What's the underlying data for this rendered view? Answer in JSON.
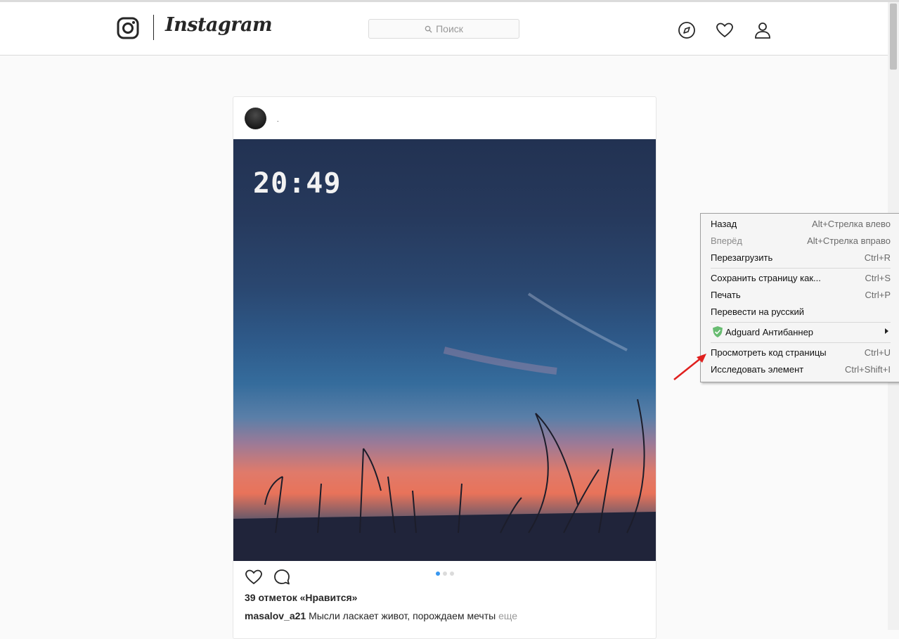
{
  "header": {
    "logo_text": "Instagram",
    "search_placeholder": "Поиск"
  },
  "post": {
    "clock_text": "20:49",
    "username_marker": ".",
    "likes": "39 отметок «Нравится»",
    "caption_user": "masalov_a21",
    "caption_text": "Мысли ласкает живот, порождаем мечты",
    "caption_more": "еще",
    "carousel_total": 3,
    "carousel_active": 1
  },
  "context_menu": {
    "items": [
      {
        "label": "Назад",
        "shortcut": "Alt+Стрелка влево",
        "enabled": true
      },
      {
        "label": "Вперёд",
        "shortcut": "Alt+Стрелка вправо",
        "enabled": false
      },
      {
        "label": "Перезагрузить",
        "shortcut": "Ctrl+R",
        "enabled": true
      },
      {
        "label": "Сохранить страницу как...",
        "shortcut": "Ctrl+S",
        "enabled": true
      },
      {
        "label": "Печать",
        "shortcut": "Ctrl+P",
        "enabled": true
      },
      {
        "label": "Перевести на русский",
        "shortcut": "",
        "enabled": true
      },
      {
        "label": "Adguard Антибаннер",
        "shortcut": "",
        "enabled": true
      },
      {
        "label": "Просмотреть код страницы",
        "shortcut": "Ctrl+U",
        "enabled": true
      },
      {
        "label": "Исследовать элемент",
        "shortcut": "Ctrl+Shift+I",
        "enabled": true
      }
    ]
  },
  "colors": {
    "accent_dot": "#3897f0",
    "annotation_arrow": "#e0201e",
    "adguard_shield": "#68bc71"
  }
}
